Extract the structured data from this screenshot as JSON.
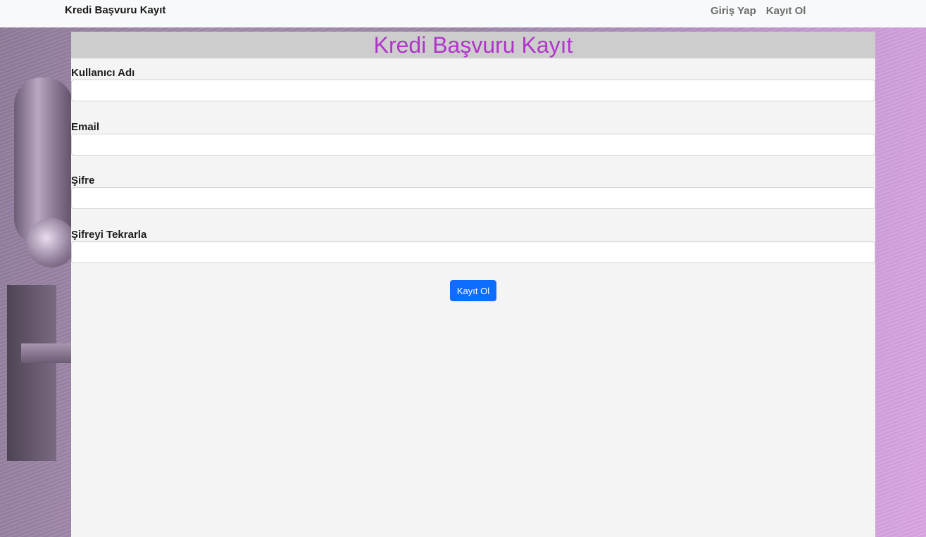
{
  "navbar": {
    "brand": "Kredi Başvuru Kayıt",
    "links": [
      "Giriş Yap",
      "Kayıt Ol"
    ]
  },
  "form": {
    "title": "Kredi Başvuru Kayıt",
    "fields": [
      {
        "label": "Kullanıcı Adı",
        "value": ""
      },
      {
        "label": "Email",
        "value": ""
      },
      {
        "label": "Şifre",
        "value": ""
      },
      {
        "label": "Şifreyi Tekrarla",
        "value": ""
      }
    ],
    "submit_label": "Kayıt Ol"
  },
  "colors": {
    "title": "#b035c9",
    "button": "#0d6efd",
    "navbar_bg": "#f8f9fa",
    "panel_bg": "#f4f4f4",
    "header_bg": "#cdcdcd"
  }
}
